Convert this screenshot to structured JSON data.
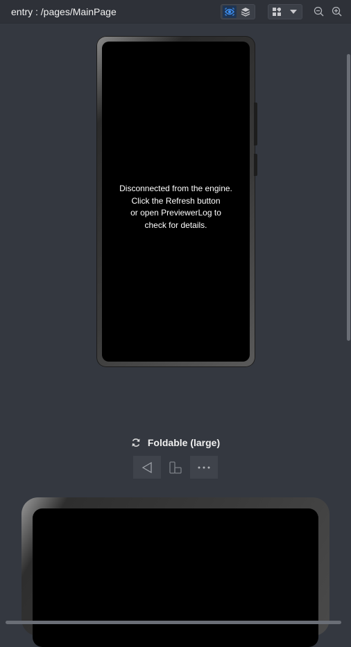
{
  "header": {
    "route": "entry : /pages/MainPage",
    "icons": {
      "preview_toggle": "eye-icon",
      "layers_toggle": "layers-icon",
      "layout_menu": "grid-icon",
      "dropdown": "chevron-down-icon",
      "zoom_out": "zoom-out-icon",
      "zoom_in": "zoom-in-icon"
    },
    "accent_color": "#1f6fd6"
  },
  "phone": {
    "message_lines": [
      "Disconnected from the engine.",
      "Click the Refresh button",
      "or open PreviewerLog to",
      "check for details."
    ]
  },
  "device": {
    "name": "Foldable (large)",
    "rotate_icon": "rotate-icon",
    "controls": [
      "back-icon",
      "fold-icon",
      "more-icon"
    ]
  }
}
